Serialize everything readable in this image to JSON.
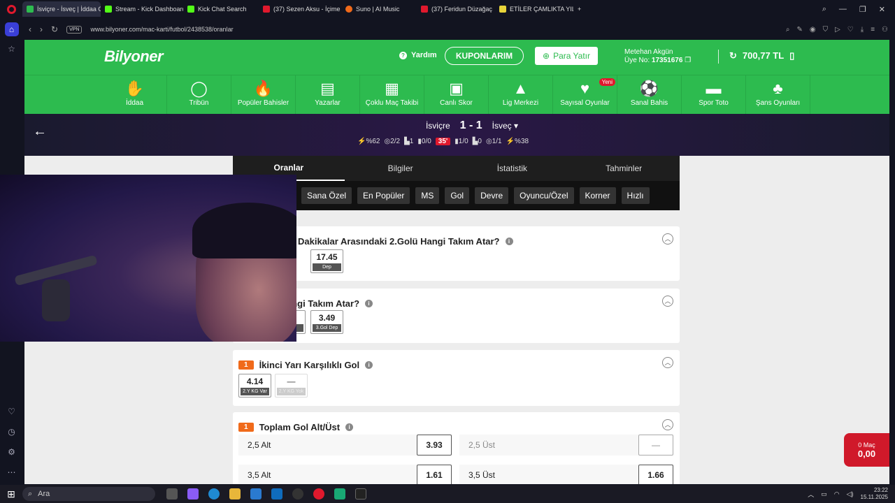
{
  "browser": {
    "tabs": [
      {
        "label": "İsviçre - İsveç | İddaa Oran",
        "color": "#2dbb4f",
        "active": true
      },
      {
        "label": "Stream - Kick Dashboard",
        "color": "#53fc18"
      },
      {
        "label": "Kick Chat Search",
        "color": "#53fc18"
      },
      {
        "label": "(37) Sezen Aksu - İçime Sı",
        "color": "#e0192d"
      },
      {
        "label": "Suno | AI Music",
        "color": "#f06a1a"
      },
      {
        "label": "(37) Feridun Düzağaç",
        "color": "#e0192d"
      },
      {
        "label": "ETİLER ÇAMLIKTA YILMAZ",
        "color": "#e8d43a"
      }
    ],
    "new_tab": "+",
    "vpn": "VPN",
    "url": "www.bilyoner.com/mac-karti/futbol/2438538/oranlar"
  },
  "site": {
    "logo": "Bilyoner",
    "help": "Yardım",
    "kuponlarim": "KUPONLARIM",
    "para_yatir": "Para Yatır",
    "user_name": "Metehan Akgün",
    "member_label": "Üye No:",
    "member_no": "17351676",
    "balance": "700,77 TL"
  },
  "nav": [
    {
      "label": "İddaa",
      "icon": "✋"
    },
    {
      "label": "Tribün",
      "icon": "◯"
    },
    {
      "label": "Popüler Bahisler",
      "icon": "🔥"
    },
    {
      "label": "Yazarlar",
      "icon": "▤"
    },
    {
      "label": "Çoklu Maç Takibi",
      "icon": "▦"
    },
    {
      "label": "Canlı Skor",
      "icon": "▣"
    },
    {
      "label": "Lig Merkezi",
      "icon": "▲"
    },
    {
      "label": "Sayısal Oyunlar",
      "icon": "♥",
      "badge": "Yeni"
    },
    {
      "label": "Sanal Bahis",
      "icon": "⚽"
    },
    {
      "label": "Spor Toto",
      "icon": "▬"
    },
    {
      "label": "Şans Oyunları",
      "icon": "♣"
    }
  ],
  "match": {
    "home": "İsviçre",
    "score": "1 - 1",
    "away": "İsveç",
    "stats": [
      "⚡%62",
      "◎2/2",
      "▙1",
      "▮0/0",
      "35'",
      "▮1/0",
      "▙0",
      "◎1/1",
      "⚡%38"
    ]
  },
  "main_tabs": [
    "Oranlar",
    "Bilgiler",
    "İstatistik",
    "Tahminler"
  ],
  "filters": [
    "Sana Özel",
    "En Popüler",
    "MS",
    "Gol",
    "Devre",
    "Oyuncu/Özel",
    "Korner",
    "Hızlı"
  ],
  "markets": {
    "m1": {
      "title": "Dakikalar Arasındaki 2.Golü Hangi Takım Atar?",
      "odd_value": "17.45",
      "odd_label": "Dep"
    },
    "m2": {
      "title": "angi Takım Atar?",
      "partial_value": "8",
      "partial_label": "z",
      "odd_value": "3.49",
      "odd_label": "3.Gol Dep"
    },
    "m3": {
      "badge": "1",
      "title": "İkinci Yarı Karşılıklı Gol",
      "odd1_value": "4.14",
      "odd1_label": "2.Y KG Var",
      "odd2_value": "—",
      "odd2_label": "2.Y KG Yok"
    },
    "m4": {
      "badge": "1",
      "title": "Toplam Gol Alt/Üst",
      "rows": [
        {
          "left_label": "2,5 Alt",
          "left_odd": "3.93",
          "right_label": "2,5 Üst",
          "right_odd": "—"
        },
        {
          "left_label": "3,5 Alt",
          "left_odd": "1.61",
          "right_label": "3,5 Üst",
          "right_odd": "1.66"
        }
      ]
    }
  },
  "coupon": {
    "count_label": "0 Maç",
    "amount": "0,00"
  },
  "taskbar": {
    "search": "Ara",
    "time": "23:22",
    "date": "15.11.2025"
  }
}
